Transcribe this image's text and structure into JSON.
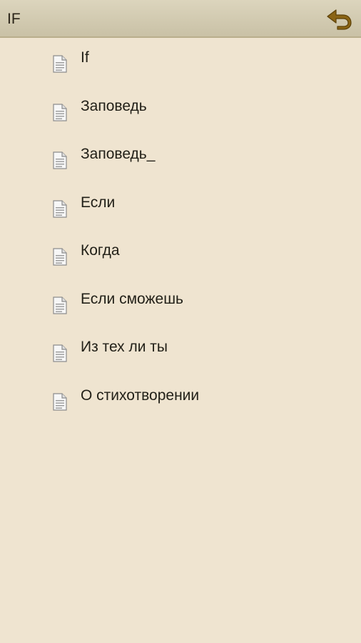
{
  "header": {
    "title": "IF",
    "back_icon": "undo-arrow-icon",
    "accent_color": "#8a6414"
  },
  "list": {
    "item_icon": "document-icon",
    "items": [
      {
        "label": "If"
      },
      {
        "label": "Заповедь"
      },
      {
        "label": "Заповедь_"
      },
      {
        "label": "Если"
      },
      {
        "label": "Когда"
      },
      {
        "label": "Если сможешь"
      },
      {
        "label": "Из тех ли ты"
      },
      {
        "label": "О стихотворении"
      }
    ]
  }
}
